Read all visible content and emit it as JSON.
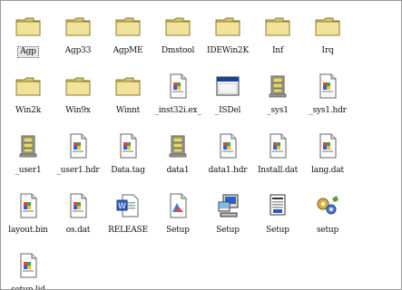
{
  "files": [
    {
      "name": "Agp",
      "icon": "folder-icon",
      "selected": true
    },
    {
      "name": "Agp33",
      "icon": "folder-icon"
    },
    {
      "name": "AgpME",
      "icon": "folder-icon"
    },
    {
      "name": "Dmstool",
      "icon": "folder-icon"
    },
    {
      "name": "IDEWin2K",
      "icon": "folder-icon"
    },
    {
      "name": "Inf",
      "icon": "folder-icon"
    },
    {
      "name": "Irq",
      "icon": "folder-icon"
    },
    {
      "name": "",
      "icon": "none"
    },
    {
      "name": "Win2k",
      "icon": "folder-icon"
    },
    {
      "name": "Win9x",
      "icon": "folder-icon"
    },
    {
      "name": "Winnt",
      "icon": "folder-icon"
    },
    {
      "name": "_inst32i.ex_",
      "icon": "generic-file-icon"
    },
    {
      "name": "_ISDel",
      "icon": "application-window-icon"
    },
    {
      "name": "_sys1",
      "icon": "cabinet-archive-icon"
    },
    {
      "name": "_sys1.hdr",
      "icon": "generic-file-icon"
    },
    {
      "name": "",
      "icon": "none"
    },
    {
      "name": "_user1",
      "icon": "cabinet-archive-icon"
    },
    {
      "name": "_user1.hdr",
      "icon": "generic-file-icon"
    },
    {
      "name": "Data.tag",
      "icon": "generic-file-icon"
    },
    {
      "name": "data1",
      "icon": "cabinet-archive-icon"
    },
    {
      "name": "data1.hdr",
      "icon": "generic-file-icon"
    },
    {
      "name": "Install.dat",
      "icon": "generic-file-icon"
    },
    {
      "name": "lang.dat",
      "icon": "generic-file-icon"
    },
    {
      "name": "",
      "icon": "none"
    },
    {
      "name": "layout.bin",
      "icon": "generic-file-icon"
    },
    {
      "name": "os.dat",
      "icon": "generic-file-icon"
    },
    {
      "name": "RELEASE",
      "icon": "word-document-icon"
    },
    {
      "name": "Setup",
      "icon": "bitmap-image-icon"
    },
    {
      "name": "Setup",
      "icon": "setup-computer-icon"
    },
    {
      "name": "Setup",
      "icon": "config-settings-icon"
    },
    {
      "name": "setup",
      "icon": "gears-icon"
    },
    {
      "name": "",
      "icon": "none"
    },
    {
      "name": "setup.lid",
      "icon": "generic-file-icon"
    }
  ],
  "colors": {
    "folder": "#e8d77a",
    "folder_dark": "#b9a646",
    "window_border": "#9a9a9a"
  }
}
